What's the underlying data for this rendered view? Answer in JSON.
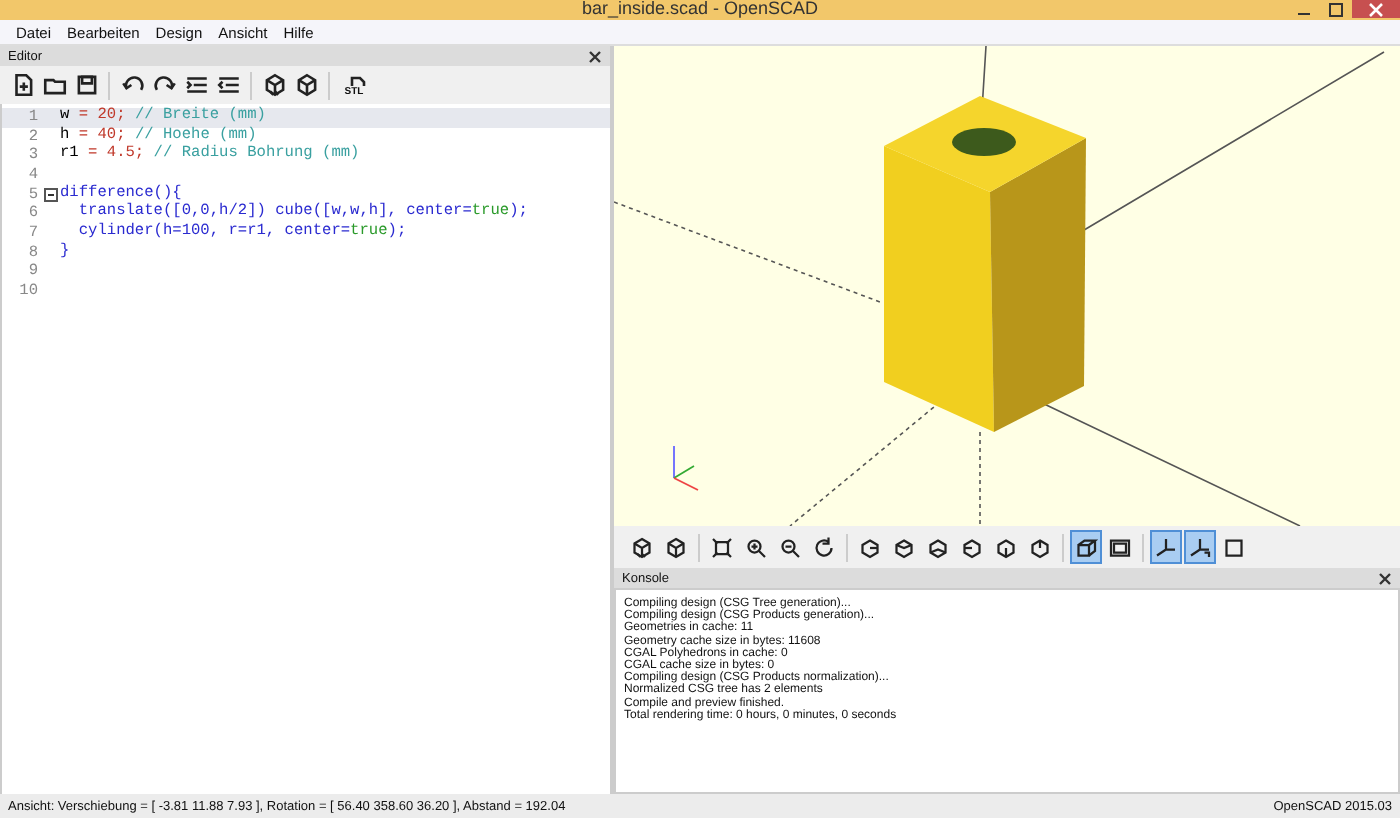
{
  "window": {
    "title": "bar_inside.scad - OpenSCAD"
  },
  "menu": [
    {
      "label": "Datei"
    },
    {
      "label": "Bearbeiten"
    },
    {
      "label": "Design"
    },
    {
      "label": "Ansicht"
    },
    {
      "label": "Hilfe"
    }
  ],
  "editor": {
    "title": "Editor",
    "toolbar": [
      {
        "kind": "new"
      },
      {
        "kind": "open"
      },
      {
        "kind": "save"
      },
      {
        "kind": "separator"
      },
      {
        "kind": "undo"
      },
      {
        "kind": "redo"
      },
      {
        "kind": "indent"
      },
      {
        "kind": "unindent"
      },
      {
        "kind": "separator"
      },
      {
        "kind": "preview"
      },
      {
        "kind": "render"
      },
      {
        "kind": "separator"
      },
      {
        "kind": "export",
        "label": "STL"
      }
    ],
    "lines": [
      {
        "number": "1",
        "current": true,
        "fold": false,
        "tokens": [
          {
            "text": "w",
            "kind": "plain"
          },
          {
            "text": " = 20;",
            "kind": "number"
          },
          {
            "text": " // Breite (mm)",
            "kind": "comment"
          }
        ]
      },
      {
        "number": "2",
        "current": false,
        "fold": false,
        "tokens": [
          {
            "text": "h",
            "kind": "plain"
          },
          {
            "text": " = 40;",
            "kind": "number"
          },
          {
            "text": " // Hoehe (mm)",
            "kind": "comment"
          }
        ]
      },
      {
        "number": "3",
        "current": false,
        "fold": false,
        "tokens": [
          {
            "text": "r1",
            "kind": "plain"
          },
          {
            "text": " = 4.5;",
            "kind": "number"
          },
          {
            "text": " // Radius Bohrung (mm)",
            "kind": "comment"
          }
        ]
      },
      {
        "number": "4",
        "current": false,
        "fold": false
      },
      {
        "number": "5",
        "current": false,
        "fold": true,
        "tokens": [
          {
            "text": "difference(){",
            "kind": "keyword"
          }
        ]
      },
      {
        "number": "6",
        "current": false,
        "fold": false,
        "tokens": [
          {
            "text": "  translate([0,0,h/2]) cube([w,w,h], center=",
            "kind": "keyword"
          },
          {
            "text": "true",
            "kind": "literal"
          },
          {
            "text": ");",
            "kind": "keyword"
          }
        ]
      },
      {
        "number": "7",
        "current": false,
        "fold": false,
        "tokens": [
          {
            "text": "  cylinder(h=100, r=r1, center=",
            "kind": "keyword"
          },
          {
            "text": "true",
            "kind": "literal"
          },
          {
            "text": ");",
            "kind": "keyword"
          }
        ]
      },
      {
        "number": "8",
        "current": false,
        "fold": false,
        "tokens": [
          {
            "text": "}",
            "kind": "keyword"
          }
        ]
      },
      {
        "number": "9",
        "current": false,
        "fold": false
      },
      {
        "number": "10",
        "current": false,
        "fold": false
      }
    ]
  },
  "view_toolbar": [
    {
      "kind": "preview",
      "selected": false
    },
    {
      "kind": "render",
      "selected": false
    },
    {
      "kind": "separator"
    },
    {
      "kind": "view-all",
      "selected": false
    },
    {
      "kind": "zoom-in",
      "selected": false
    },
    {
      "kind": "zoom-out",
      "selected": false
    },
    {
      "kind": "reset",
      "selected": false
    },
    {
      "kind": "separator"
    },
    {
      "kind": "right",
      "selected": false
    },
    {
      "kind": "top",
      "selected": false
    },
    {
      "kind": "bottom",
      "selected": false
    },
    {
      "kind": "left",
      "selected": false
    },
    {
      "kind": "front",
      "selected": false
    },
    {
      "kind": "back",
      "selected": false
    },
    {
      "kind": "separator"
    },
    {
      "kind": "perspective",
      "selected": true
    },
    {
      "kind": "orthogonal",
      "selected": false
    },
    {
      "kind": "separator"
    },
    {
      "kind": "axes",
      "selected": true
    },
    {
      "kind": "scale",
      "selected": true
    },
    {
      "kind": "crosshairs",
      "selected": false
    }
  ],
  "console": {
    "title": "Konsole",
    "lines": [
      "Compiling design (CSG Tree generation)...",
      "Compiling design (CSG Products generation)...",
      "Geometries in cache: 11",
      "Geometry cache size in bytes: 11608",
      "CGAL Polyhedrons in cache: 0",
      "CGAL cache size in bytes: 0",
      "Compiling design (CSG Products normalization)...",
      "Normalized CSG tree has 2 elements",
      "Compile and preview finished.",
      "Total rendering time: 0 hours, 0 minutes, 0 seconds"
    ]
  },
  "status_bar": {
    "left": "Ansicht: Verschiebung = [ -3.81 11.88 7.93 ], Rotation = [ 56.40 358.60 36.20 ], Abstand = 192.04",
    "right": "OpenSCAD 2015.03"
  }
}
